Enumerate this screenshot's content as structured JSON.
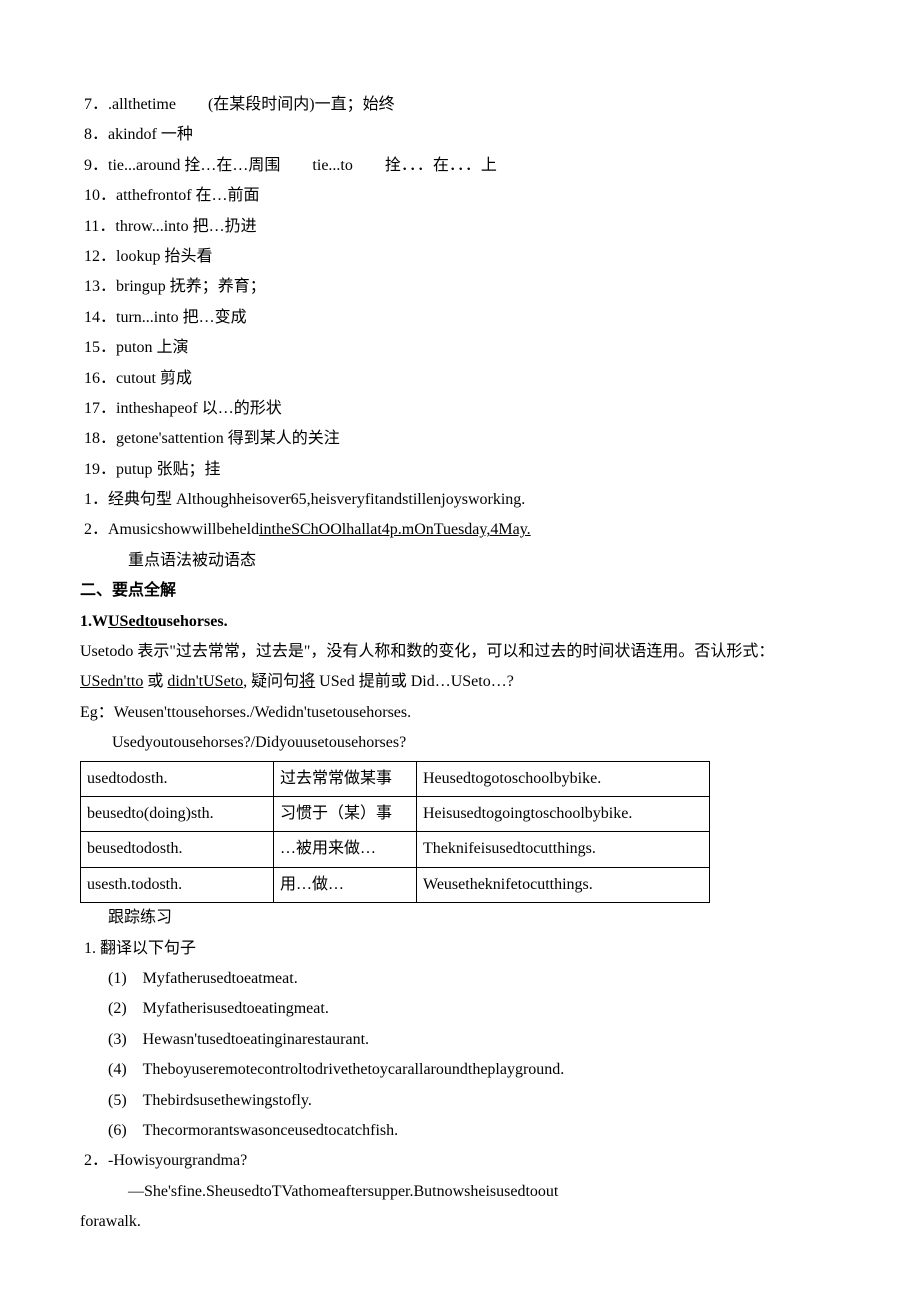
{
  "list1": [
    "7．.allthetime　　(在某段时间内)一直；始终",
    "8．akindof 一种",
    "9．tie...around 拴…在…周围　　tie...to　　拴．．．在．．．上",
    "10．atthefrontof 在…前面",
    "11．throw...into 把…扔进",
    "12．lookup 抬头看",
    "13．bringup 抚养；养育；",
    "14．turn...into 把…变成",
    "15．puton 上演",
    "16．cutout 剪成",
    "17．intheshapeof 以…的形状",
    "18．getone'sattention 得到某人的关注",
    "19．putup 张贴；挂"
  ],
  "list2a": "1．经典句型 Althoughheisover65,heisveryfitandstillenjoysworking.",
  "list2b_pre": "2．Amusicshowwillbeheld",
  "list2b_und": "intheSChOOlhall",
  "list2b_mid": "at4p.mOnTuesday,4May.",
  "grammar_note": "重点语法被动语态",
  "section2": "二、要点全解",
  "heading1_pre": "1.W",
  "heading1_und": "USedto",
  "heading1_post": "usehorses.",
  "p1_pre": "Usetodo 表示\"过去常常，过去是\"，没有人称和数的变化，可以和过去的时间状语连用。否认形式：",
  "p1_u1": "USedn'tto",
  "p1_mid1": " 或 ",
  "p1_u2": "didn'tUSeto",
  "p1_mid2": ", 疑问句",
  "p1_u3": "将",
  "p1_mid3": " USed 提前或 Did…USeto…?",
  "eg1": "Eg：Weusen'ttousehorses./Wedidn'tusetousehorses.",
  "eg2": "　　Usedyoutousehorses?/Didyouusetousehorses?",
  "table": {
    "r1c1": "usedtodosth.",
    "r1c2": "过去常常做某事",
    "r1c3": "Heusedtogotoschoolbybike.",
    "r2c1": "beusedto(doing)sth.",
    "r2c2": "习惯于（某）事",
    "r2c3": "Heisusedtogoingtoschoolbybike.",
    "r3c1": "beusedtodosth.",
    "r3c2": "…被用来做…",
    "r3c3": "Theknifeisusedtocutthings.",
    "r4c1": "usesth.todosth.",
    "r4c2": "用…做…",
    "r4c3": "Weusetheknifetocutthings."
  },
  "follow": "跟踪练习",
  "ex1": "1. 翻译以下句子",
  "ex_items": [
    "(1)　Myfatherusedtoeatmeat.",
    "(2)　Myfatherisusedtoeatingmeat.",
    "(3)　Hewasn'tusedtoeatinginarestaurant.",
    "(4)　Theboyuseremotecontroltodrivethetoycarallaroundtheplayground.",
    "(5)　Thebirdsusethewingstofly.",
    "(6)　Thecormorantswasonceusedtocatchfish."
  ],
  "ex2a": "2．-Howisyourgrandma?",
  "ex2b": "—She'sfine.SheusedtoTVathomeaftersupper.Butnowsheisusedtoout",
  "ex2c": "forawalk."
}
